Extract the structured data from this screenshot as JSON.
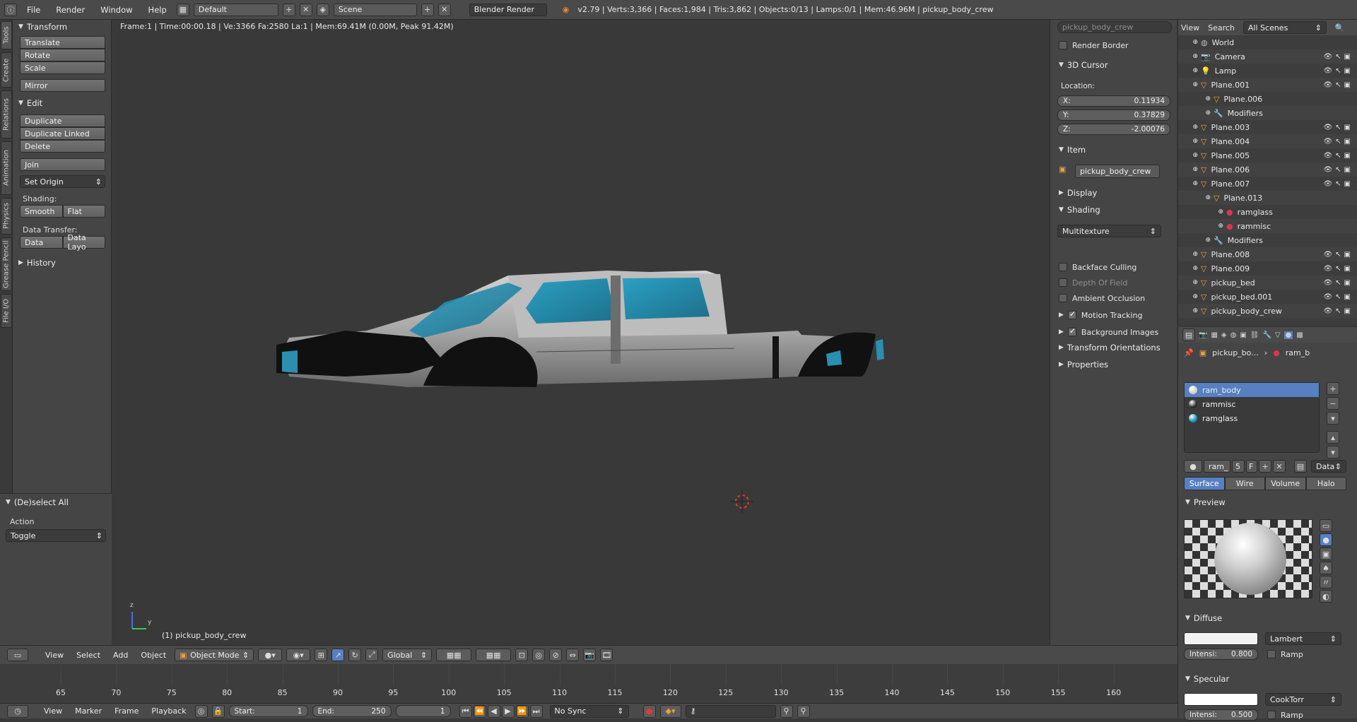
{
  "topbar": {
    "menus": [
      "File",
      "Render",
      "Window",
      "Help"
    ],
    "layout": "Default",
    "scene": "Scene",
    "engine": "Blender Render",
    "stats": "v2.79 | Verts:3,366 | Faces:1,984 | Tris:3,862 | Objects:0/13 | Lamps:0/1 | Mem:46.96M | pickup_body_crew"
  },
  "side_tabs": [
    "Tools",
    "Create",
    "Relations",
    "Animation",
    "Physics",
    "Grease Pencil",
    "File I/O"
  ],
  "toolshelf": {
    "transform_title": "Transform",
    "transform_buttons": [
      "Translate",
      "Rotate",
      "Scale"
    ],
    "mirror": "Mirror",
    "edit_title": "Edit",
    "edit_buttons": [
      "Duplicate",
      "Duplicate Linked",
      "Delete"
    ],
    "join": "Join",
    "set_origin": "Set Origin",
    "shading_label": "Shading:",
    "smooth": "Smooth",
    "flat": "Flat",
    "data_transfer_label": "Data Transfer:",
    "data": "Data",
    "data_layout": "Data Layo",
    "history_title": "History"
  },
  "last_operator": {
    "title": "(De)select All",
    "action_label": "Action",
    "action_value": "Toggle"
  },
  "viewport": {
    "info": "Frame:1 | Time:00:00.18 | Ve:3366 Fa:2580 La:1 | Mem:69.41M (0.00M, Peak 91.42M)",
    "object_label": "(1) pickup_body_crew",
    "axis_z": "z",
    "axis_y": "y"
  },
  "npanel": {
    "object_name": "pickup_body_crew",
    "render_border": "Render Border",
    "cursor_title": "3D Cursor",
    "location_label": "Location:",
    "x_label": "X:",
    "x": "0.11934",
    "y_label": "Y:",
    "y": "0.37829",
    "z_label": "Z:",
    "z": "-2.00076",
    "item_title": "Item",
    "item_name": "pickup_body_crew",
    "display_title": "Display",
    "shading_title": "Shading",
    "shading_mode": "Multitexture",
    "backface": "Backface Culling",
    "depth_of_field": "Depth Of Field",
    "ambient_occlusion": "Ambient Occlusion",
    "motion_tracking": "Motion Tracking",
    "background_images": "Background Images",
    "transform_orientations": "Transform Orientations",
    "properties": "Properties"
  },
  "outliner": {
    "header_view": "View",
    "header_search": "Search",
    "header_scenes": "All Scenes",
    "rows": [
      {
        "label": "World",
        "indent": 1
      },
      {
        "label": "Camera",
        "indent": 1
      },
      {
        "label": "Lamp",
        "indent": 1
      },
      {
        "label": "Plane.001",
        "indent": 1
      },
      {
        "label": "Plane.006",
        "indent": 2
      },
      {
        "label": "Modifiers",
        "indent": 2
      },
      {
        "label": "Plane.003",
        "indent": 1
      },
      {
        "label": "Plane.004",
        "indent": 1
      },
      {
        "label": "Plane.005",
        "indent": 1
      },
      {
        "label": "Plane.006",
        "indent": 1
      },
      {
        "label": "Plane.007",
        "indent": 1
      },
      {
        "label": "Plane.013",
        "indent": 2
      },
      {
        "label": "ramglass",
        "indent": 3
      },
      {
        "label": "rammisc",
        "indent": 3
      },
      {
        "label": "Modifiers",
        "indent": 2
      },
      {
        "label": "Plane.008",
        "indent": 1
      },
      {
        "label": "Plane.009",
        "indent": 1
      },
      {
        "label": "pickup_bed",
        "indent": 1
      },
      {
        "label": "pickup_bed.001",
        "indent": 1
      },
      {
        "label": "pickup_body_crew",
        "indent": 1
      }
    ]
  },
  "properties": {
    "breadcrumb_object": "pickup_bo...",
    "breadcrumb_material": "ram_b",
    "materials": [
      {
        "name": "ram_body",
        "color": "#cfcfcf"
      },
      {
        "name": "rammisc",
        "color": "#2a2a2a"
      },
      {
        "name": "ramglass",
        "color": "#1d8fb8"
      }
    ],
    "mat_name": "ram_",
    "mat_users": "5",
    "mat_f": "F",
    "data_select": "Data",
    "tabs": [
      "Surface",
      "Wire",
      "Volume",
      "Halo"
    ],
    "preview_title": "Preview",
    "diffuse_title": "Diffuse",
    "diffuse_shader": "Lambert",
    "intensity_label": "Intensi:",
    "diffuse_intensity": "0.800",
    "ramp": "Ramp",
    "specular_title": "Specular",
    "specular_shader": "CookTorr",
    "specular_intensity": "0.500"
  },
  "view3d_header": {
    "menus": [
      "View",
      "Select",
      "Add",
      "Object"
    ],
    "mode": "Object Mode",
    "orientation": "Global"
  },
  "timeline": {
    "ticks": [
      65,
      70,
      75,
      80,
      85,
      90,
      95,
      100,
      105,
      110,
      115,
      120,
      125,
      130,
      135,
      140,
      145,
      150,
      155,
      160
    ],
    "menus": [
      "View",
      "Marker",
      "Frame",
      "Playback"
    ],
    "start_label": "Start:",
    "start": "1",
    "end_label": "End:",
    "end": "250",
    "current": "1",
    "sync": "No Sync"
  },
  "colors": {
    "accent": "#5680c2",
    "panel": "#454545",
    "viewport": "#393939"
  }
}
